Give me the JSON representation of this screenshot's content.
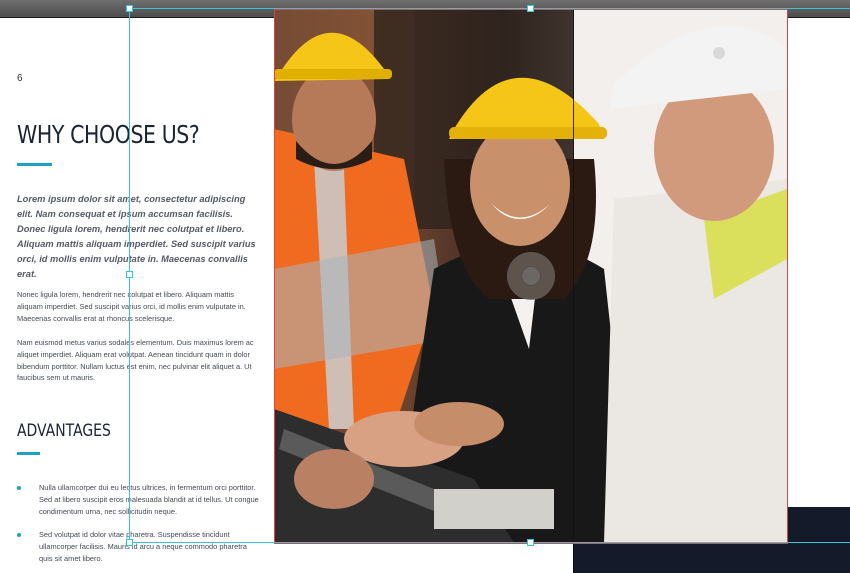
{
  "page": {
    "page_number": "6",
    "heading": "WHY CHOOSE US?",
    "intro": "Lorem ipsum dolor sit amet, consectetur adipiscing elit. Nam consequat et ipsum accumsan facilisis. Donec ligula lorem, hendrerit nec  colutpat et libero. Aliquam mattis aliquam imperdiet. Sed suscipit varius orci, id mollis enim vulputate in. Maecenas convallis erat.",
    "paragraphs": [
      "Nonec ligula lorem, hendrerit nec colutpat et libero. Aliquam mattis aliquam imperdiet. Sed suscipit varius orci, id mollis enim vulputate in. Maecenas convallis erat at rhoncus scelerisque.",
      "Nam euismod metus varius sodales elementum. Duis maximus lorem ac aliquet imperdiet. Aliquam erat volutpat. Aenean tincidunt quam in dolor bibendum porttitor. Nullam luctus est enim, nec pulvinar elit aliquet a. Ut faucibus sem ut mauris."
    ],
    "subheading": "ADVANTAGES",
    "bullets": [
      "Nulla ullamcorper dui eu lectus ultrices, in fermentum orci porttitor. Sed at libero suscipit eros malesuada blandit at id tellus. Ut congue condimentum urna, nec sollicitudin neque.",
      "Sed volutpat id dolor vitae pharetra. Suspendisse tincidunt ullamcorper facilisis. Mauris id arcu a neque commodo pharetra quis sit amet libero."
    ]
  },
  "photo": {
    "subject": "construction-workers-with-tablet",
    "hardhat_color": "#f5c518",
    "vest_color": "#f06a1f"
  },
  "colors": {
    "accent": "#1ea1c9",
    "heading": "#1a2433",
    "guide": "#35c6d8",
    "frame": "#e0443e",
    "dark_block": "#141a29"
  }
}
